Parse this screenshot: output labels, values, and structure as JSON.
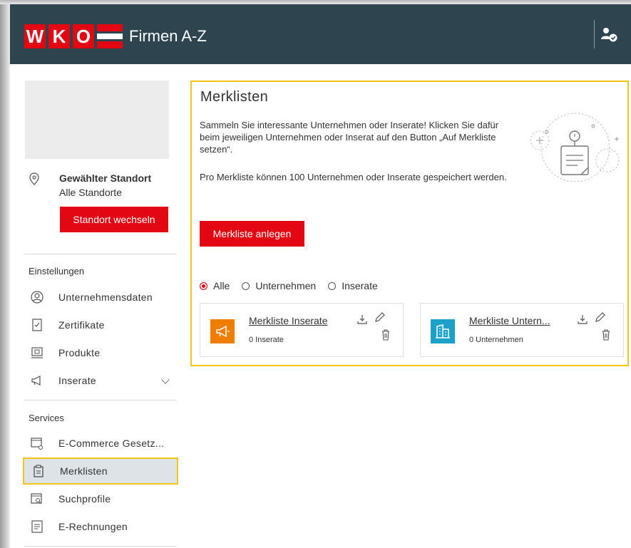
{
  "header": {
    "logo_letters": [
      "W",
      "K",
      "O"
    ],
    "app_title": "Firmen A-Z",
    "user_icon": "user-check-icon"
  },
  "sidebar": {
    "location": {
      "icon": "location-pin-icon",
      "label": "Gewählter Standort",
      "value": "Alle Standorte",
      "button": "Standort wechseln"
    },
    "sections": [
      {
        "title": "Einstellungen",
        "items": [
          {
            "label": "Unternehmensdaten",
            "icon": "user-circle-icon"
          },
          {
            "label": "Zertifikate",
            "icon": "certificate-icon"
          },
          {
            "label": "Produkte",
            "icon": "product-icon"
          },
          {
            "label": "Inserate",
            "icon": "megaphone-icon",
            "has_chevron": true
          }
        ]
      },
      {
        "title": "Services",
        "items": [
          {
            "label": "E-Commerce Gesetz...",
            "icon": "ecommerce-icon"
          },
          {
            "label": "Merklisten",
            "icon": "clipboard-icon",
            "active": true
          },
          {
            "label": "Suchprofile",
            "icon": "search-profile-icon"
          },
          {
            "label": "E-Rechnungen",
            "icon": "invoice-icon"
          }
        ]
      }
    ]
  },
  "main": {
    "title": "Merklisten",
    "description": "Sammeln Sie interessante Unternehmen oder Inserate! Klicken Sie dafür beim jeweiligen Unternehmen oder Inserat auf den Button „Auf Merkliste setzen“.",
    "description2": "Pro Merkliste können 100 Unternehmen oder Inserate gespeichert werden.",
    "illustration": "notes-illustration",
    "create_button": "Merkliste anlegen",
    "filters": [
      {
        "label": "Alle",
        "checked": true
      },
      {
        "label": "Unternehmen",
        "checked": false
      },
      {
        "label": "Inserate",
        "checked": false
      }
    ],
    "cards": [
      {
        "title": "Merkliste Inserate",
        "count": "0 Inserate",
        "icon": "megaphone-icon",
        "color": "#ef7d00"
      },
      {
        "title": "Merkliste Untern...",
        "count": "0 Unternehmen",
        "icon": "building-icon",
        "color": "#1ca1c9"
      }
    ]
  },
  "colors": {
    "header_bg": "#2e4550",
    "brand_red": "#e30613",
    "highlight": "#f0c419",
    "active_bg": "#dde3e6"
  }
}
